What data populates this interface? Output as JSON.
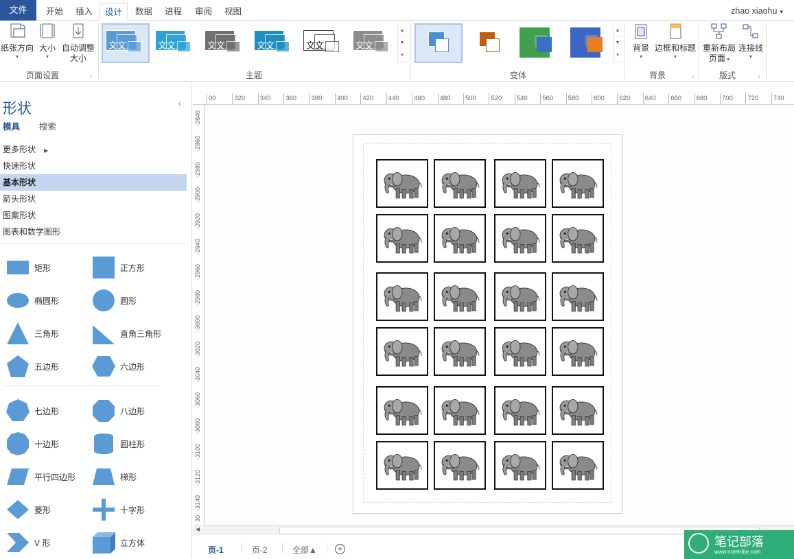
{
  "tabs": {
    "file": "文件",
    "items": [
      "开始",
      "插入",
      "设计",
      "数据",
      "进程",
      "审阅",
      "视图"
    ],
    "active": "设计"
  },
  "user": "zhao xiaohu",
  "ribbon": {
    "page_setup": {
      "orientation": "纸张方向",
      "size": "大小",
      "auto_size_line1": "自动调整",
      "auto_size_line2": "大小",
      "label": "页面设置"
    },
    "themes": {
      "sample_text": "文文",
      "label": "主题",
      "colors": [
        "#5b9bd5",
        "#2fa0d8",
        "#707070",
        "#1e8ec1",
        "#ffffff",
        "#8c8c8c"
      ]
    },
    "variants": {
      "label": "变体",
      "colors": [
        "#4a90d9",
        "#c55a11",
        "#3ea14b",
        "#3a67c4"
      ]
    },
    "backgrounds": {
      "background": "背景",
      "borders_titles": "边框和标题",
      "label": "背景"
    },
    "layout": {
      "relayout_line1": "重新布局",
      "relayout_line2": "页面",
      "connectors": "连接线",
      "label": "版式"
    }
  },
  "shapes_panel": {
    "title": "形状",
    "tab_stencils": "模具",
    "tab_search": "搜索",
    "categories": [
      "更多形状",
      "快速形状",
      "基本形状",
      "箭头形状",
      "图案形状",
      "图表和数学图形"
    ],
    "active_category": "基本形状",
    "shapes": [
      "矩形",
      "正方形",
      "椭圆形",
      "圆形",
      "三角形",
      "直角三角形",
      "五边形",
      "六边形",
      "七边形",
      "八边形",
      "十边形",
      "圆柱形",
      "平行四边形",
      "梯形",
      "菱形",
      "十字形",
      "V 形",
      "立方体"
    ],
    "shape_color": "#5b9bd5"
  },
  "rulers": {
    "horizontal": [
      "00",
      "320",
      "340",
      "360",
      "380",
      "400",
      "420",
      "440",
      "460",
      "480",
      "500",
      "520",
      "540",
      "560",
      "580",
      "600",
      "620",
      "640",
      "660",
      "680",
      "700",
      "720",
      "740"
    ],
    "vertical": [
      "-2840",
      "-2860",
      "-2880",
      "-2900",
      "-2920",
      "-2940",
      "-2960",
      "-2980",
      "-3000",
      "-3020",
      "-3040",
      "-3060",
      "-3080",
      "-3100",
      "-3120",
      "-3140",
      "30"
    ]
  },
  "canvas": {
    "grid_rows": 6,
    "grid_cols": 4,
    "cell_image": "elephant-icon"
  },
  "page_tabs": {
    "items": [
      "页-1",
      "页-2",
      "全部▲"
    ],
    "active": "页-1"
  },
  "watermark": {
    "text": "笔记部落",
    "url": "www.notetribe.com"
  }
}
